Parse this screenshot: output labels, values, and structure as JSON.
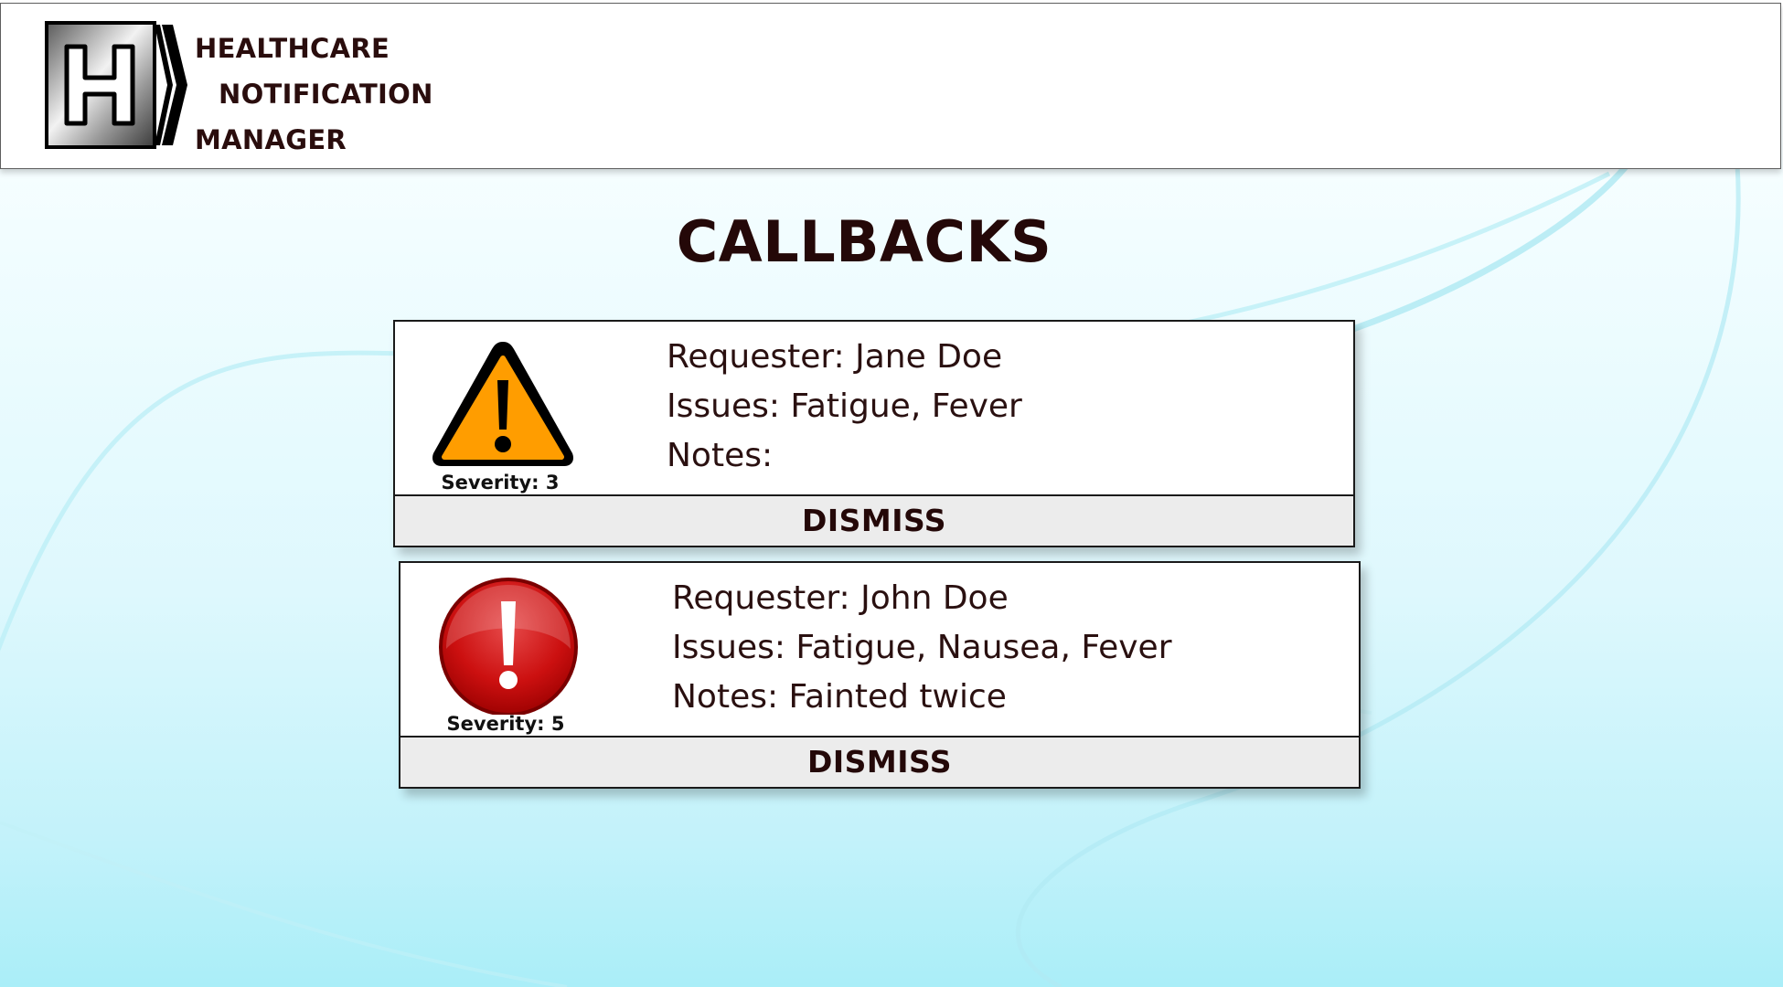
{
  "app": {
    "title_lines": [
      "HEALTHCARE",
      "NOTIFICATION",
      "MANAGER"
    ],
    "logo_letter": "H"
  },
  "page": {
    "title": "CALLBACKS"
  },
  "callbacks": [
    {
      "severity_label": "Severity: 3",
      "severity_level": 3,
      "icon": "warning-triangle-icon",
      "requester": "Requester: Jane Doe",
      "issues": "Issues: Fatigue, Fever",
      "notes": "Notes:",
      "dismiss_label": "DISMISS"
    },
    {
      "severity_label": "Severity: 5",
      "severity_level": 5,
      "icon": "alert-circle-icon",
      "requester": "Requester: John Doe",
      "issues": "Issues: Fatigue, Nausea, Fever",
      "notes": "Notes: Fainted twice",
      "dismiss_label": "DISMISS"
    }
  ],
  "colors": {
    "text_dark": "#240808",
    "warning_orange": "#ff9d00",
    "alert_red": "#cc0000",
    "dismiss_bg": "#ececec"
  }
}
